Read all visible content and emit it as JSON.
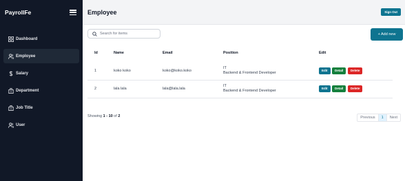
{
  "app": {
    "brand": "PayrollFe"
  },
  "sidebar": {
    "items": [
      {
        "label": "Dashboard",
        "icon": "grid-icon",
        "active": false
      },
      {
        "label": "Employee",
        "icon": "users-icon",
        "active": true
      },
      {
        "label": "Salary",
        "icon": "dollar-icon",
        "active": false
      },
      {
        "label": "Department",
        "icon": "building-icon",
        "active": false
      },
      {
        "label": "Job Title",
        "icon": "building-icon",
        "active": false
      },
      {
        "label": "User",
        "icon": "users-icon",
        "active": false
      }
    ]
  },
  "header": {
    "title": "Employee",
    "signout_label": "Sign Out"
  },
  "toolbar": {
    "search_placeholder": "Search for items",
    "add_label": "+ Add new"
  },
  "table": {
    "headers": {
      "id": "Id",
      "name": "Name",
      "email": "Email",
      "position": "Position",
      "edit": "Edit"
    },
    "rows": [
      {
        "id": "1",
        "name": "koko koko",
        "email": "koko@koko.koko",
        "position_line1": "IT",
        "position_line2": "Backend & Frontend Developer"
      },
      {
        "id": "2",
        "name": "lala lala",
        "email": "lala@lala.lala",
        "position_line1": "IT",
        "position_line2": "Backend & Frontend Developer"
      }
    ],
    "actions": {
      "edit": "Edit",
      "detail_row1": "Detail",
      "detail_row2": "Detail",
      "delete": "Delete"
    }
  },
  "footer": {
    "showing_prefix": "Showing ",
    "showing_range": "1 - 10",
    "showing_of": " of ",
    "showing_total": "2"
  },
  "pager": {
    "previous": "Previous",
    "current": "1",
    "next": "Next"
  },
  "colors": {
    "sidebar_bg": "#111827",
    "accent": "#0e7490",
    "detail": "#15803d",
    "danger": "#dc2626"
  }
}
